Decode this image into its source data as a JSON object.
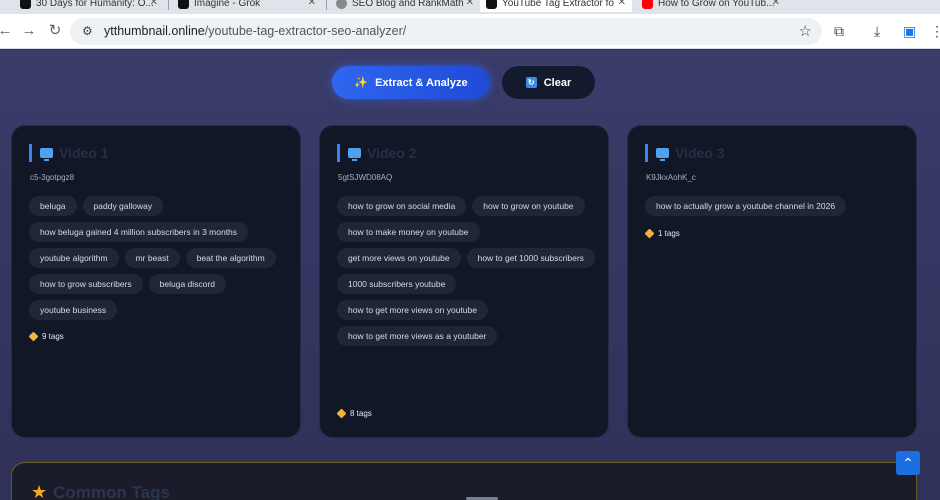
{
  "browser": {
    "tabs": [
      {
        "title": "30 Days for Humanity: O...",
        "icon_color": "#111111",
        "active": false
      },
      {
        "title": "Imagine - Grok",
        "icon_color": "#111111",
        "active": false
      },
      {
        "title": "SEO Blog and RankMath",
        "icon_color": "#888888",
        "active": false
      },
      {
        "title": "YouTube Tag Extractor fo",
        "icon_color": "#111111",
        "active": true
      },
      {
        "title": "How to Grow on YouTub...",
        "icon_color": "#ff0000",
        "active": false
      }
    ],
    "url_host": "ytthumbnail.online",
    "url_path": "/youtube-tag-extractor-seo-analyzer/"
  },
  "actions": {
    "extract_label": "Extract & Analyze",
    "clear_label": "Clear"
  },
  "videos": [
    {
      "title": "Video 1",
      "id": "c5-3gotpgz8",
      "tags": [
        "beluga",
        "paddy galloway",
        "how beluga gained 4 million subscribers in 3 months",
        "youtube algorithm",
        "mr beast",
        "beat the algorithm",
        "how to grow subscribers",
        "beluga discord",
        "youtube business"
      ],
      "tag_count": "9 tags"
    },
    {
      "title": "Video 2",
      "id": "5gtSJWD08AQ",
      "tags": [
        "how to grow on social media",
        "how to grow on youtube",
        "how to make money on youtube",
        "get more views on youtube",
        "how to get 1000 subscribers",
        "1000 subscribers youtube",
        "how to get more views on youtube",
        "how to get more views as a youtuber"
      ],
      "tag_count": "8 tags"
    },
    {
      "title": "Video 3",
      "id": "K9JkxAohK_c",
      "tags": [
        "how to actually grow a youtube channel in 2026"
      ],
      "tag_count": "1 tags"
    }
  ],
  "common": {
    "title": "Common Tags"
  }
}
